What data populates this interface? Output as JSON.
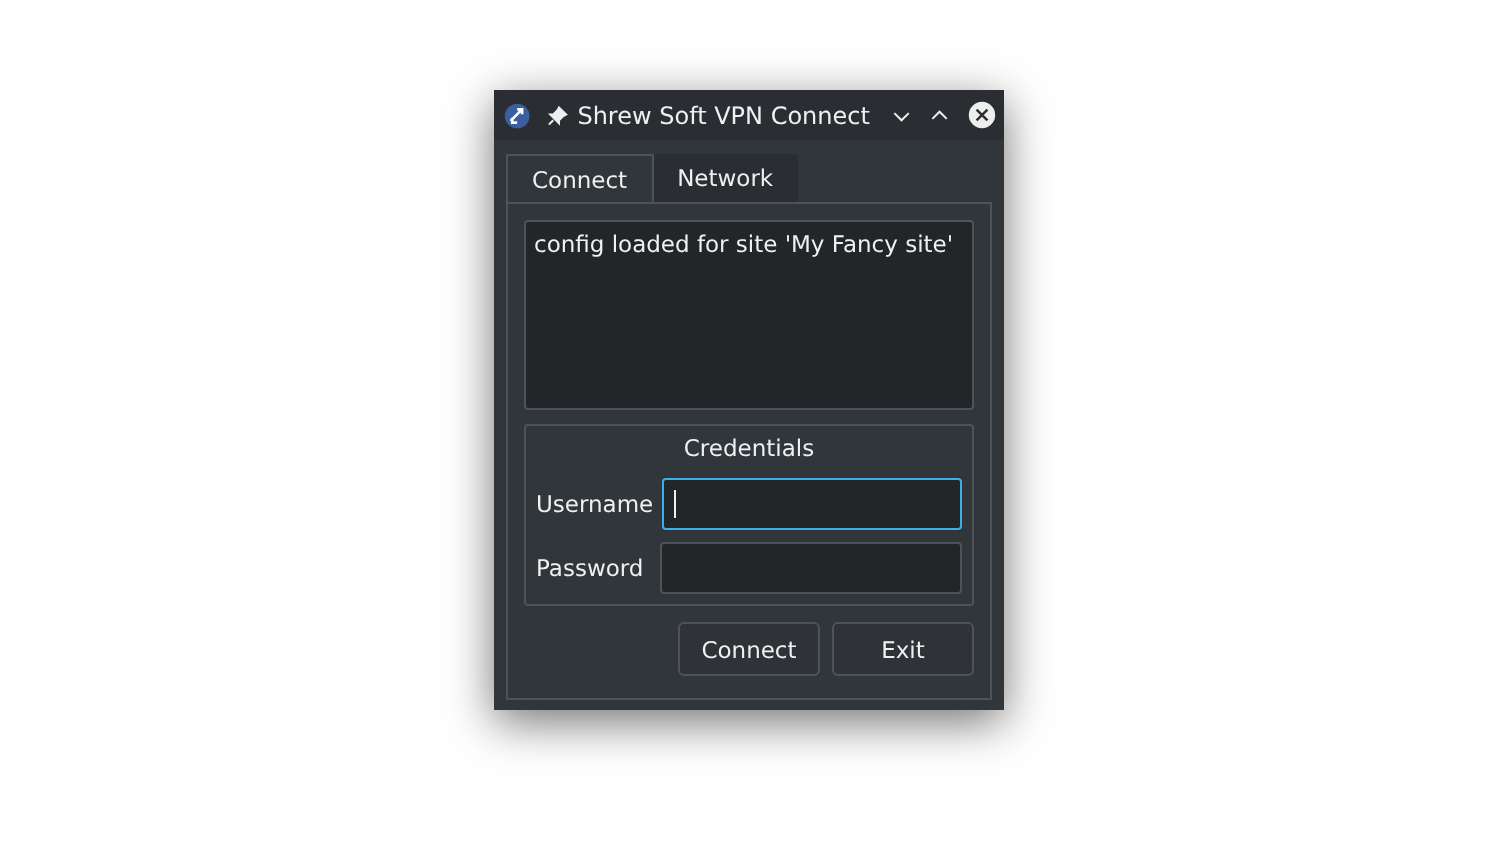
{
  "window": {
    "title": "Shrew Soft VPN Connect"
  },
  "tabs": [
    {
      "label": "Connect",
      "selected": true
    },
    {
      "label": "Network",
      "selected": false
    }
  ],
  "log": "config loaded for site 'My Fancy site'",
  "credentials": {
    "title": "Credentials",
    "fields": [
      {
        "label": "Username",
        "focused": true
      },
      {
        "label": "Password",
        "focused": false
      }
    ]
  },
  "buttons": [
    "Connect",
    "Exit"
  ]
}
